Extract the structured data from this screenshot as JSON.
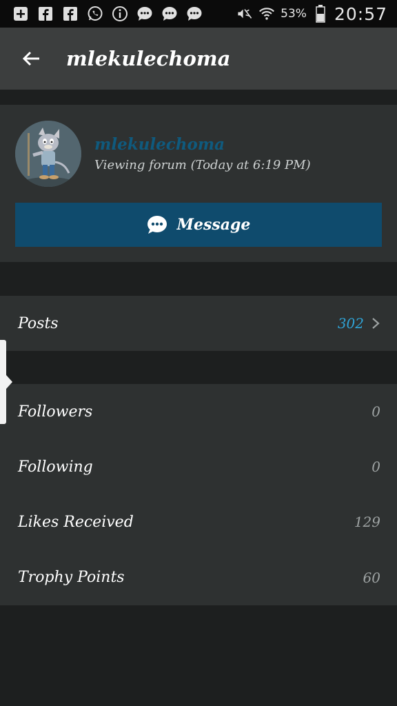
{
  "status_bar": {
    "battery_percent": "53%",
    "time": "20:57",
    "icons": [
      "add-box-icon",
      "facebook-icon",
      "facebook-icon",
      "whatsapp-icon",
      "info-icon",
      "chat-bubble-icon",
      "chat-bubble-icon",
      "chat-bubble-icon",
      "mute-icon",
      "wifi-icon",
      "battery-icon"
    ]
  },
  "app_bar": {
    "title": "mlekulechoma"
  },
  "profile": {
    "username": "mlekulechoma",
    "status": "Viewing forum (Today at 6:19 PM)",
    "message_label": "Message",
    "accent_color": "#0f4b6d",
    "username_color": "#0f5a7e"
  },
  "stats": {
    "posts": {
      "label": "Posts",
      "value": "302"
    },
    "followers": {
      "label": "Followers",
      "value": "0"
    },
    "following": {
      "label": "Following",
      "value": "0"
    },
    "likes": {
      "label": "Likes Received",
      "value": "129"
    },
    "trophy": {
      "label": "Trophy Points",
      "value": "60"
    }
  }
}
